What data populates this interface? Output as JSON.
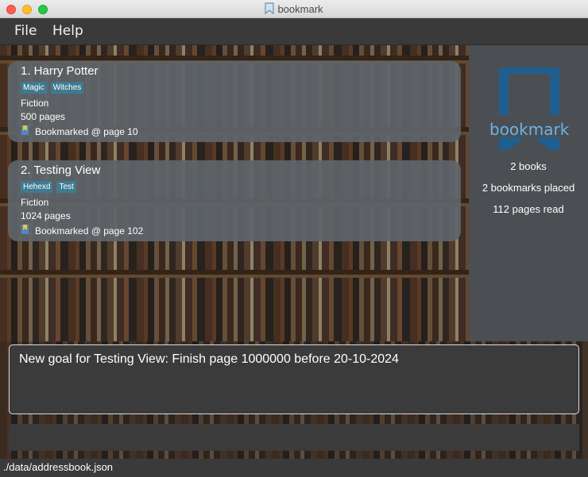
{
  "window": {
    "title": "bookmark"
  },
  "menu": {
    "file": "File",
    "help": "Help"
  },
  "books": [
    {
      "title": "1.  Harry Potter",
      "tags": [
        "Magic",
        "Witches"
      ],
      "genre": "Fiction",
      "pages": "500 pages",
      "bookmark": "Bookmarked @ page 10"
    },
    {
      "title": "2.  Testing View",
      "tags": [
        "Hehexd",
        "Test"
      ],
      "genre": "Fiction",
      "pages": "1024 pages",
      "bookmark": "Bookmarked @ page 102"
    }
  ],
  "stats": {
    "logo_text": "bookmark",
    "books": "2 books",
    "bookmarks": "2 bookmarks placed",
    "pages_read": "112 pages read"
  },
  "result": {
    "text": "New goal for Testing View: Finish page 1000000 before 20-10-2024"
  },
  "command": {
    "value": ""
  },
  "status": {
    "path": "./data/addressbook.json"
  },
  "colors": {
    "tag": "#3e7b91",
    "logo": "#1f5f8f",
    "logo_text": "#6bb3e8",
    "panel": "#4b4f53"
  },
  "icons": {
    "title": "bookmark-icon",
    "card_bookmark": "bookmark-badge-icon"
  }
}
